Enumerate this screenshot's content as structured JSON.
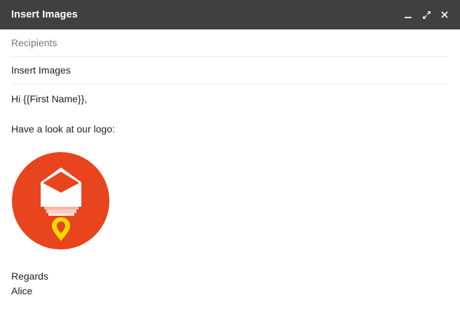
{
  "window": {
    "title": "Insert Images",
    "controls": {
      "minimize_icon": "minimize-icon",
      "popout_icon": "expand-icon",
      "close_icon": "close-icon"
    }
  },
  "compose": {
    "recipients_placeholder": "Recipients",
    "subject": "Insert Images"
  },
  "message": {
    "greeting": "Hi {{First Name}},",
    "intro": "Have a look at our logo:",
    "closing": "Regards",
    "signature": "Alice"
  },
  "logo": {
    "icon": "envelope-rocket-logo",
    "colors": {
      "circle": "#E8441E",
      "envelope": "#FFFFFF",
      "trail": "#F6B8A6",
      "pin": "#F5D800"
    }
  },
  "colors": {
    "titlebar": "#404040",
    "title_text": "#FFFFFF",
    "placeholder": "#787878",
    "divider": "#ECECEC"
  }
}
